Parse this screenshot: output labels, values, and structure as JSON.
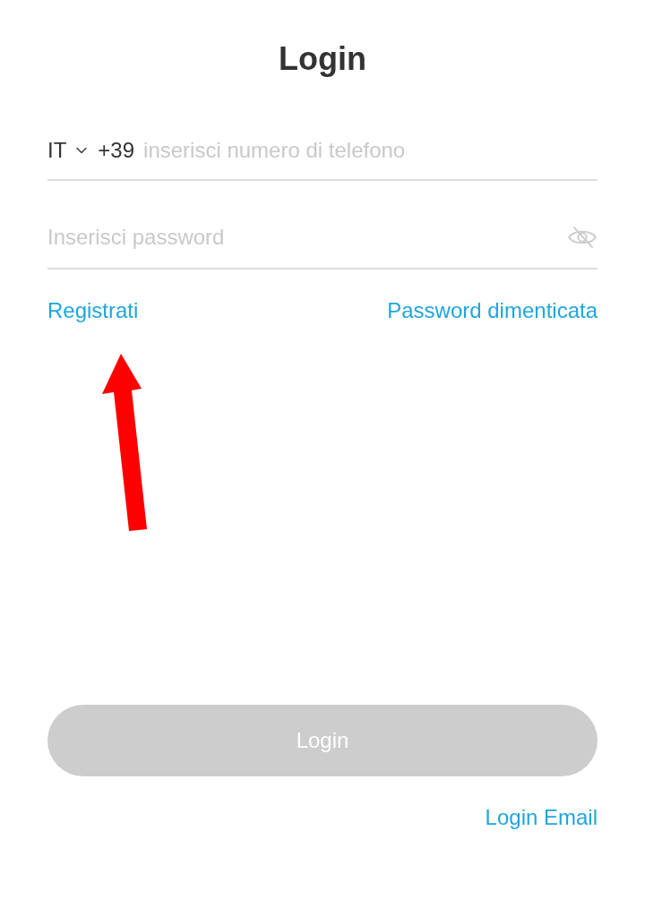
{
  "title": "Login",
  "phone": {
    "country": "IT",
    "dial_code": "+39",
    "placeholder": "inserisci numero di telefono"
  },
  "password": {
    "placeholder": "Inserisci password",
    "visible": false
  },
  "links": [
    {
      "label": "Registrati"
    },
    {
      "label": "Password dimenticata"
    }
  ],
  "login_button": {
    "label": "Login",
    "disabled": true
  },
  "alt_login": {
    "label": "Login Email"
  },
  "annotations": [
    {
      "kind": "arrow"
    }
  ]
}
